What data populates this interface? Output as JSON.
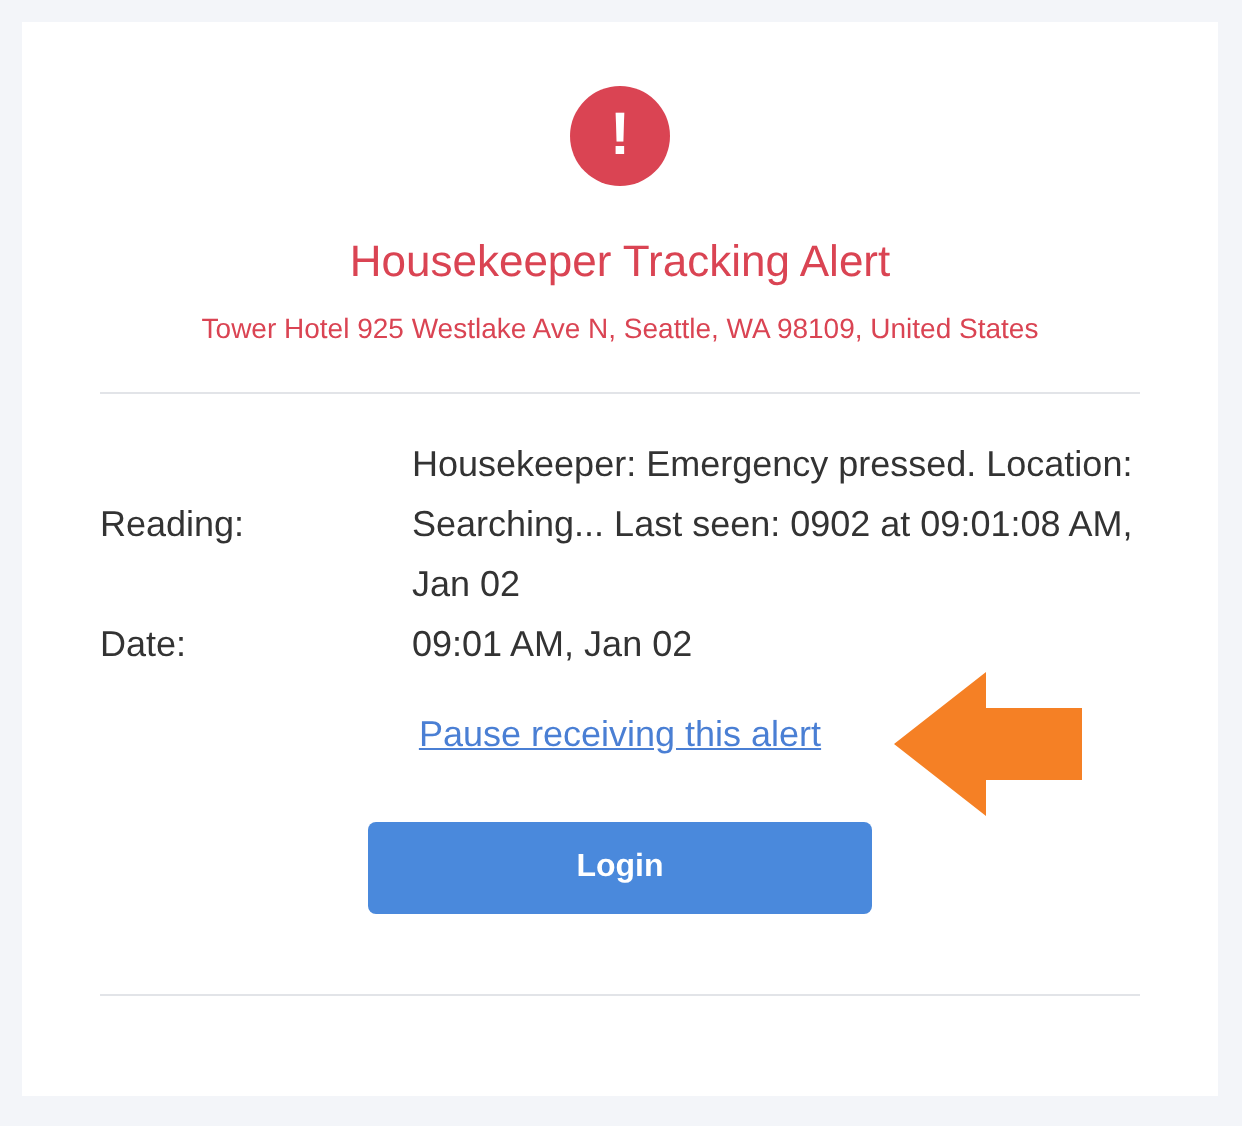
{
  "alert": {
    "icon": "!",
    "title": "Housekeeper Tracking Alert",
    "address": "Tower Hotel 925 Westlake Ave N, Seattle, WA 98109, United States"
  },
  "fields": [
    {
      "label": "Reading:",
      "value": "Housekeeper: Emergency pressed. Location: Searching... Last seen: 0902 at 09:01:08 AM, Jan 02"
    },
    {
      "label": "Date:",
      "value": "09:01 AM, Jan 02"
    }
  ],
  "link": "Pause receiving this alert",
  "button": "Login"
}
